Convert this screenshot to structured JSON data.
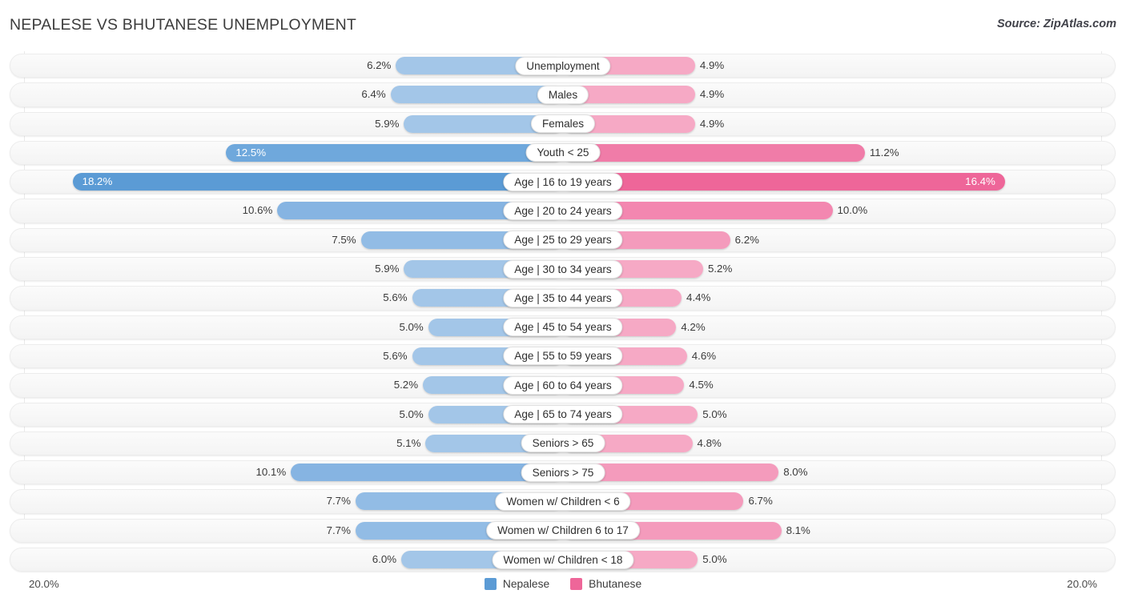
{
  "header": {
    "title": "NEPALESE VS BHUTANESE UNEMPLOYMENT",
    "source": "Source: ZipAtlas.com"
  },
  "axis": {
    "left_label": "20.0%",
    "right_label": "20.0%",
    "max": 20.0
  },
  "legend": [
    {
      "name": "Nepalese",
      "color": "#5B9BD5"
    },
    {
      "name": "Bhutanese",
      "color": "#EE6699"
    }
  ],
  "colors": {
    "nepalese_light": "#A3C6E8",
    "nepalese_mid": "#86B4E2",
    "nepalese_dark": "#5B9BD5",
    "bhutanese_light": "#F6A9C5",
    "bhutanese_mid": "#F387B0",
    "bhutanese_dark": "#EE6699",
    "track": "#F6F6F6",
    "gridline": "#E9E9E9"
  },
  "chart_data": {
    "type": "bar",
    "subtype": "diverging-bar",
    "title": "NEPALESE VS BHUTANESE UNEMPLOYMENT",
    "xlabel": "",
    "ylabel": "",
    "xlim": [
      20.0,
      20.0
    ],
    "grid": true,
    "legend_position": "bottom-center",
    "categories": [
      "Unemployment",
      "Males",
      "Females",
      "Youth < 25",
      "Age | 16 to 19 years",
      "Age | 20 to 24 years",
      "Age | 25 to 29 years",
      "Age | 30 to 34 years",
      "Age | 35 to 44 years",
      "Age | 45 to 54 years",
      "Age | 55 to 59 years",
      "Age | 60 to 64 years",
      "Age | 65 to 74 years",
      "Seniors > 65",
      "Seniors > 75",
      "Women w/ Children < 6",
      "Women w/ Children 6 to 17",
      "Women w/ Children < 18"
    ],
    "series": [
      {
        "name": "Nepalese",
        "side": "left",
        "color": "#5B9BD5",
        "values": [
          6.2,
          6.4,
          5.9,
          12.5,
          18.2,
          10.6,
          7.5,
          5.9,
          5.6,
          5.0,
          5.6,
          5.2,
          5.0,
          5.1,
          10.1,
          7.7,
          7.7,
          6.0
        ],
        "labels": [
          "6.2%",
          "6.4%",
          "5.9%",
          "12.5%",
          "18.2%",
          "10.6%",
          "7.5%",
          "5.9%",
          "5.6%",
          "5.0%",
          "5.6%",
          "5.2%",
          "5.0%",
          "5.1%",
          "10.1%",
          "7.7%",
          "7.7%",
          "6.0%"
        ]
      },
      {
        "name": "Bhutanese",
        "side": "right",
        "color": "#EE6699",
        "values": [
          4.9,
          4.9,
          4.9,
          11.2,
          16.4,
          10.0,
          6.2,
          5.2,
          4.4,
          4.2,
          4.6,
          4.5,
          5.0,
          4.8,
          8.0,
          6.7,
          8.1,
          5.0
        ],
        "labels": [
          "4.9%",
          "4.9%",
          "4.9%",
          "11.2%",
          "16.4%",
          "10.0%",
          "6.2%",
          "5.2%",
          "4.4%",
          "4.2%",
          "4.6%",
          "4.5%",
          "5.0%",
          "4.8%",
          "8.0%",
          "6.7%",
          "8.1%",
          "5.0%"
        ]
      }
    ]
  }
}
